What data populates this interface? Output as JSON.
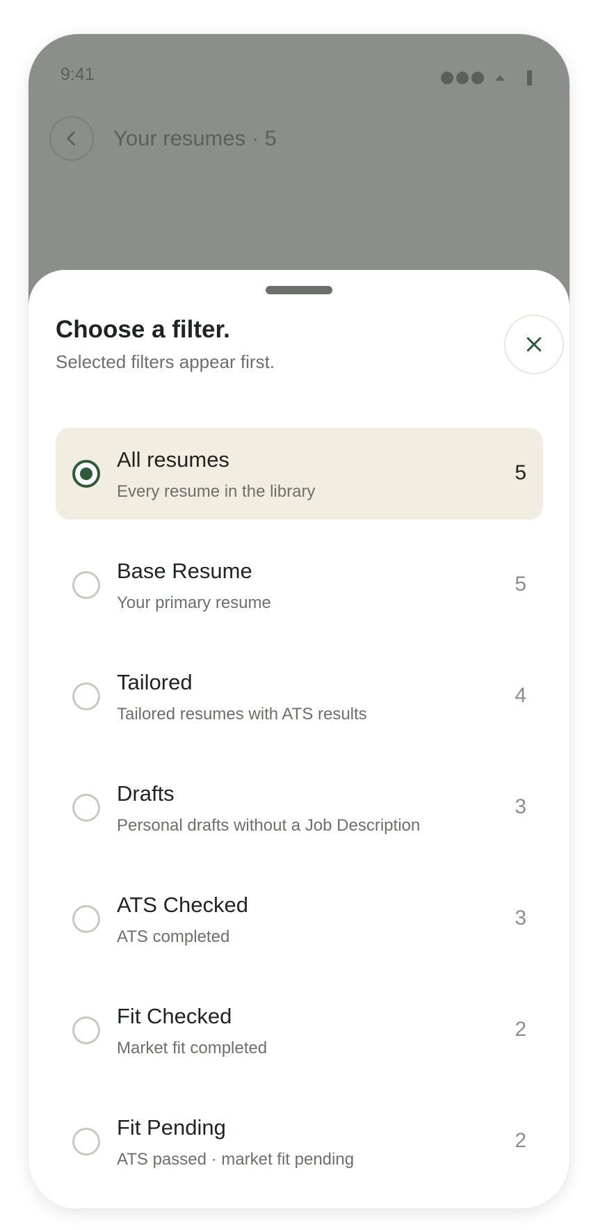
{
  "status_bar": {
    "time": "9:41"
  },
  "header": {
    "title": "Your resumes · 5",
    "back_icon": "chevron-left-icon"
  },
  "sheet": {
    "title": "Choose a filter.",
    "subtitle": "Selected filters appear first.",
    "close_icon": "close-icon"
  },
  "filters": [
    {
      "label": "All resumes",
      "description": "Every resume in the library",
      "count": "5",
      "selected": true
    },
    {
      "label": "Base Resume",
      "description": "Your primary resume",
      "count": "5",
      "selected": false
    },
    {
      "label": "Tailored",
      "description": "Tailored resumes with ATS results",
      "count": "4",
      "selected": false
    },
    {
      "label": "Drafts",
      "description": "Personal drafts without a Job Description",
      "count": "3",
      "selected": false
    },
    {
      "label": "ATS Checked",
      "description": "ATS completed",
      "count": "3",
      "selected": false
    },
    {
      "label": "Fit Checked",
      "description": "Market fit completed",
      "count": "2",
      "selected": false
    },
    {
      "label": "Fit Pending",
      "description": "ATS passed · market fit pending",
      "count": "2",
      "selected": false
    }
  ],
  "colors": {
    "accent": "#2d5a3a",
    "selected_bg": "#f1ede1",
    "overlay": "#8a8f8a"
  }
}
